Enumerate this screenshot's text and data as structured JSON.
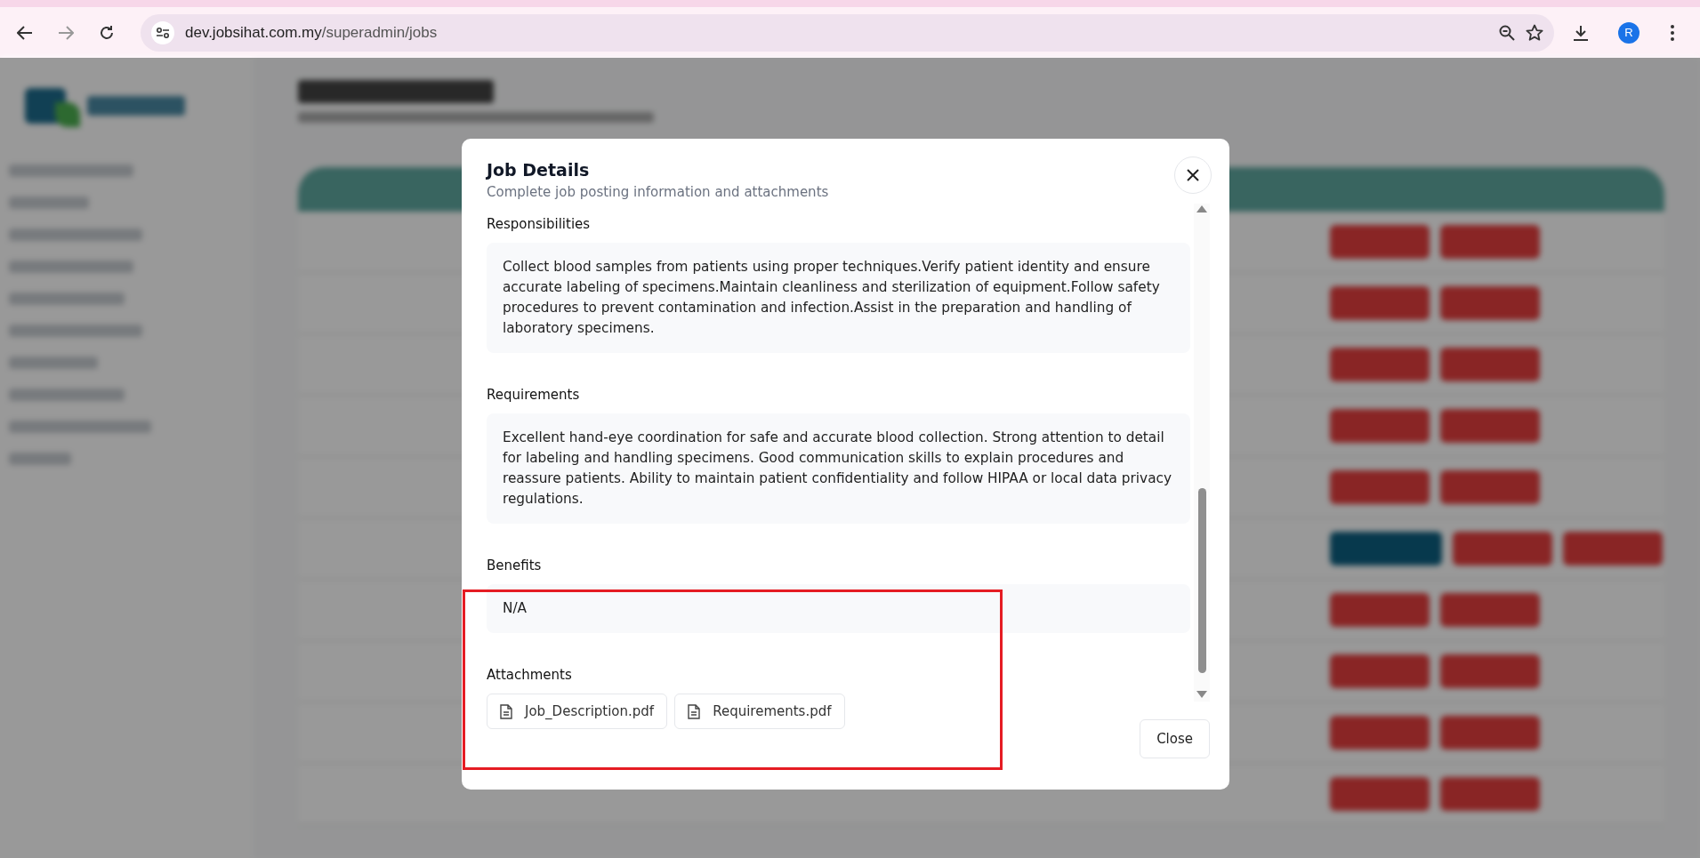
{
  "browser": {
    "url_host": "dev.jobsihat.com.my",
    "url_path": "/superadmin/jobs",
    "profile_initial": "R"
  },
  "dialog": {
    "title": "Job Details",
    "subtitle": "Complete job posting information and attachments",
    "sections": [
      {
        "kind": "text",
        "label": "Responsibilities",
        "text": "Collect blood samples from patients using proper techniques.Verify patient identity and ensure accurate labeling of specimens.Maintain cleanliness and sterilization of equipment.Follow safety procedures to prevent contamination and infection.Assist in the preparation and handling of laboratory specimens."
      },
      {
        "kind": "text",
        "label": "Requirements",
        "text": "Excellent hand-eye coordination for safe and accurate blood collection. Strong attention to detail for labeling and handling specimens. Good communication skills to explain procedures and reassure patients. Ability to maintain patient confidentiality and follow HIPAA or local data privacy regulations."
      },
      {
        "kind": "text",
        "label": "Benefits",
        "text": "N/A"
      },
      {
        "kind": "attachments",
        "label": "Attachments",
        "files": [
          "Job_Description.pdf",
          "Requirements.pdf"
        ]
      }
    ],
    "close_button": "Close"
  }
}
